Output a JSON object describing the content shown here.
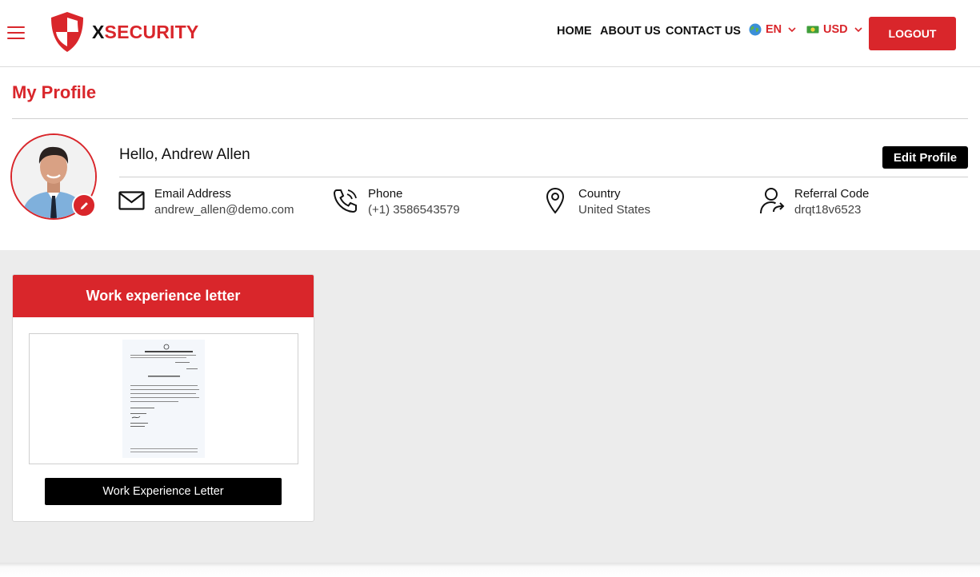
{
  "header": {
    "brand_prefix": "X",
    "brand_rest": "SECURITY",
    "nav": {
      "home": "HOME",
      "about": "ABOUT US",
      "contact": "CONTACT US"
    },
    "language": {
      "selected": "EN",
      "icon": "globe-icon"
    },
    "currency": {
      "selected": "USD",
      "icon": "banknote-icon"
    },
    "logout_label": "LOGOUT",
    "colors": {
      "brand": "#d9262b",
      "text": "#111111"
    }
  },
  "profile": {
    "page_title": "My Profile",
    "greeting": "Hello, Andrew Allen",
    "edit_label": "Edit Profile",
    "fields": {
      "email": {
        "label": "Email Address",
        "value": "andrew_allen@demo.com",
        "icon": "envelope-icon"
      },
      "phone": {
        "label": "Phone",
        "value": "(+1) 3586543579",
        "icon": "phone-icon"
      },
      "country": {
        "label": "Country",
        "value": "United States",
        "icon": "location-pin-icon"
      },
      "referral": {
        "label": "Referral Code",
        "value": "drqt18v6523",
        "icon": "user-share-icon"
      }
    }
  },
  "documents": {
    "card_title": "Work experience letter",
    "button_label": "Work Experience Letter"
  }
}
